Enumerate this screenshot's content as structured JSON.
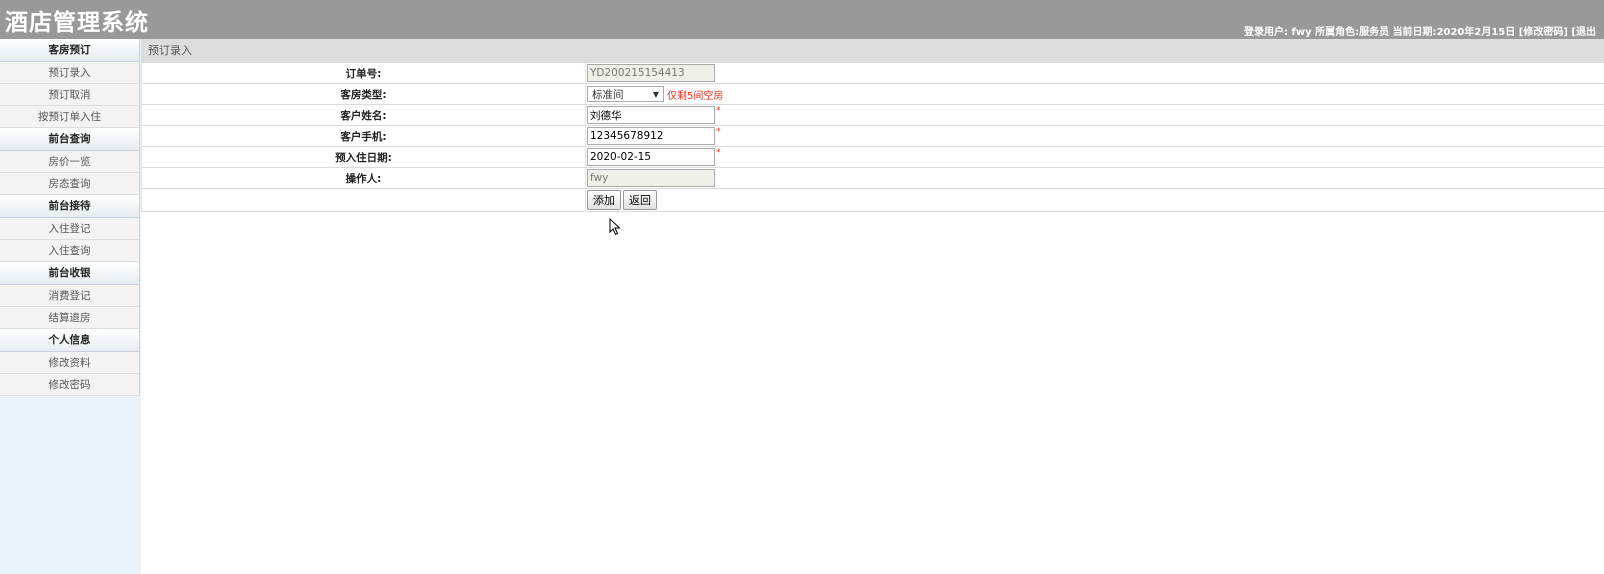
{
  "header": {
    "title": "酒店管理系统",
    "user_label": "登录用户:",
    "user_name": "fwy",
    "role_label": "所属角色:",
    "role": "服务员",
    "date_label": "当前日期:",
    "date": "2020年2月15日",
    "change_password_link": "[修改密码]",
    "logout_link": "[退出"
  },
  "sidebar": {
    "groups": [
      {
        "title": "客房预订",
        "items": [
          "预订录入",
          "预订取消",
          "按预订单入住"
        ]
      },
      {
        "title": "前台查询",
        "items": [
          "房价一览",
          "房态查询"
        ]
      },
      {
        "title": "前台接待",
        "items": [
          "入住登记",
          "入住查询"
        ]
      },
      {
        "title": "前台收银",
        "items": [
          "消费登记",
          "结算退房"
        ]
      },
      {
        "title": "个人信息",
        "items": [
          "修改资料",
          "修改密码"
        ]
      }
    ]
  },
  "main": {
    "breadcrumb": "预订录入",
    "form": {
      "order_no": {
        "label": "订单号:",
        "value": "YD200215154413"
      },
      "room_type": {
        "label": "客房类型:",
        "value": "标准间",
        "note": "仅剩5间空房"
      },
      "customer_name": {
        "label": "客户姓名:",
        "value": "刘德华"
      },
      "customer_phone": {
        "label": "客户手机:",
        "value": "12345678912"
      },
      "checkin_date": {
        "label": "预入住日期:",
        "value": "2020-02-15"
      },
      "operator": {
        "label": "操作人:",
        "value": "fwy"
      },
      "required_mark": "*"
    },
    "buttons": {
      "add": "添加",
      "back": "返回"
    }
  },
  "icons": {
    "dropdown": "chevron-down-icon",
    "cursor": "mouse-pointer-icon"
  }
}
